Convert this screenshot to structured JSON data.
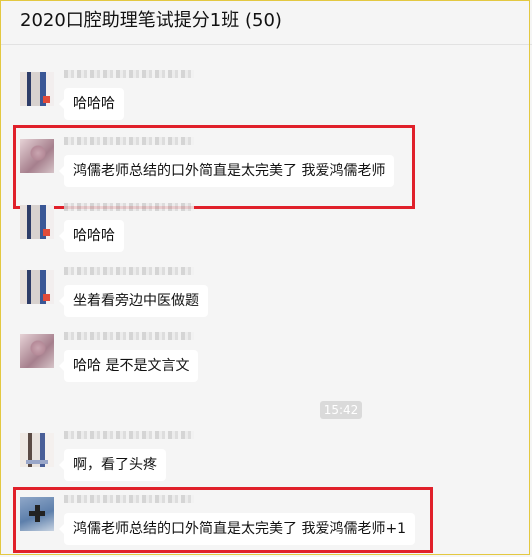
{
  "chat": {
    "title": "2020口腔助理笔试提分1班 (50)",
    "timestamp": "15:42",
    "messages": [
      {
        "text": "哈哈哈"
      },
      {
        "text": "鸿儒老师总结的口外简直是太完美了 我爱鸿儒老师"
      },
      {
        "text": "哈哈哈"
      },
      {
        "text": "坐着看旁边中医做题"
      },
      {
        "text": "哈哈 是不是文言文"
      },
      {
        "text": "啊，看了头疼"
      },
      {
        "text": "鸿儒老师总结的口外简直是太完美了 我爱鸿儒老师+1"
      }
    ]
  },
  "colors": {
    "background": "#f5f5f5",
    "bubble": "#ffffff",
    "highlight": "#e0202a",
    "frame": "#e3c840"
  }
}
